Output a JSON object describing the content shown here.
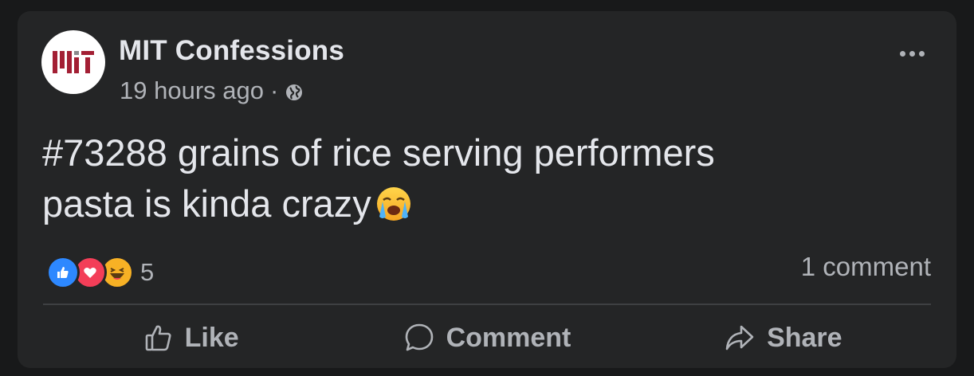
{
  "post": {
    "author": "MIT Confessions",
    "avatar_logo_text": "MIT",
    "timestamp": "19 hours ago",
    "separator": "·",
    "privacy_icon": "globe-icon",
    "text_line1": "#73288 grains of rice serving performers",
    "text_line2": "pasta is kinda crazy",
    "emoji": "loudly-crying-face"
  },
  "reactions": {
    "icons": [
      "like-reaction-icon",
      "love-reaction-icon",
      "haha-reaction-icon"
    ],
    "count": "5"
  },
  "comments": {
    "count_label": "1 comment"
  },
  "actions": {
    "like": "Like",
    "comment": "Comment",
    "share": "Share"
  },
  "colors": {
    "background": "#18191a",
    "card": "#242526",
    "primary_text": "#e4e6eb",
    "secondary_text": "#b0b3b8",
    "mit_red": "#a31f34",
    "mit_gray": "#8a8b8c",
    "like_blue": "#2d88ff",
    "love_red": "#f33e58",
    "haha_yellow": "#f7b125"
  }
}
